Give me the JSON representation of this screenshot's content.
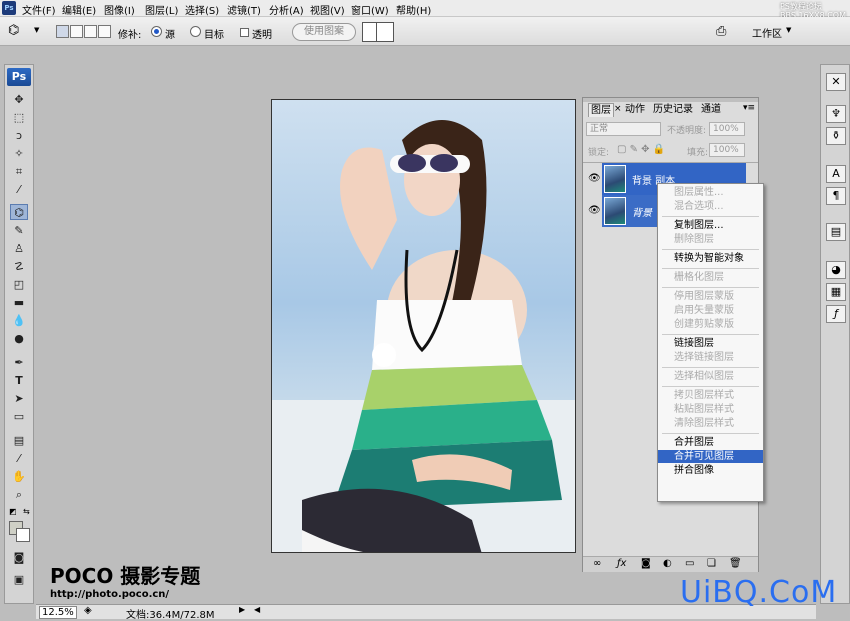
{
  "app": {
    "logo": "Ps"
  },
  "menu": [
    "文件(F)",
    "编辑(E)",
    "图像(I)",
    "图层(L)",
    "选择(S)",
    "滤镜(T)",
    "分析(A)",
    "视图(V)",
    "窗口(W)",
    "帮助(H)"
  ],
  "brand_top": "PS教程论坛\nBBS.16XX8.COM",
  "options": {
    "repair_label": "修补:",
    "source_label": "源",
    "target_label": "目标",
    "transparent_label": "透明",
    "use_pattern_label": "使用图案",
    "workspace_label": "工作区"
  },
  "layers_panel": {
    "tabs": [
      "图层",
      "动作",
      "历史记录",
      "通道"
    ],
    "blend_mode": "正常",
    "opacity_label": "不透明度:",
    "opacity_value": "100%",
    "lock_label": "锁定:",
    "fill_label": "填充:",
    "fill_value": "100%",
    "layers": [
      {
        "name": "背景 副本",
        "selected": true
      },
      {
        "name": "背景",
        "selected": false
      }
    ]
  },
  "context_menu": [
    {
      "label": "图层属性...",
      "enabled": false
    },
    {
      "label": "混合选项...",
      "enabled": false
    },
    {
      "sep": true
    },
    {
      "label": "复制图层...",
      "enabled": true
    },
    {
      "label": "删除图层",
      "enabled": false
    },
    {
      "sep": true
    },
    {
      "label": "转换为智能对象",
      "enabled": true
    },
    {
      "sep": true
    },
    {
      "label": "栅格化图层",
      "enabled": false
    },
    {
      "sep": true
    },
    {
      "label": "停用图层蒙版",
      "enabled": false
    },
    {
      "label": "启用矢量蒙版",
      "enabled": false
    },
    {
      "label": "创建剪贴蒙版",
      "enabled": false
    },
    {
      "sep": true
    },
    {
      "label": "链接图层",
      "enabled": true
    },
    {
      "label": "选择链接图层",
      "enabled": false
    },
    {
      "sep": true
    },
    {
      "label": "选择相似图层",
      "enabled": false
    },
    {
      "sep": true
    },
    {
      "label": "拷贝图层样式",
      "enabled": false
    },
    {
      "label": "粘贴图层样式",
      "enabled": false
    },
    {
      "label": "清除图层样式",
      "enabled": false
    },
    {
      "sep": true
    },
    {
      "label": "合并图层",
      "enabled": true
    },
    {
      "label": "合并可见图层",
      "enabled": true,
      "highlighted": true
    },
    {
      "label": "拼合图像",
      "enabled": true
    }
  ],
  "status": {
    "zoom": "12.5%",
    "doc": "文档:36.4M/72.8M"
  },
  "watermark": {
    "poco_title": "POCO 摄影专题",
    "poco_url": "http://photo.poco.cn/",
    "uibq": "UiBQ.CoM"
  },
  "colors": {
    "highlight": "#3265c5",
    "layer_selected": "#3265c5",
    "uibq": "#2a6ef0"
  }
}
